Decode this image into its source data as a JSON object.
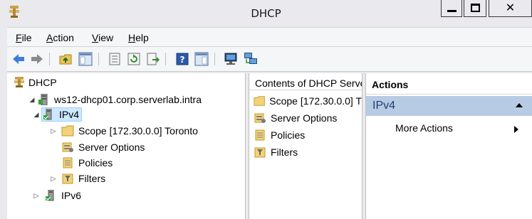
{
  "window": {
    "title": "DHCP"
  },
  "menu": {
    "file": {
      "key": "F",
      "rest": "ile"
    },
    "action": {
      "key": "A",
      "rest": "ction"
    },
    "view": {
      "key": "V",
      "rest": "iew"
    },
    "help": {
      "key": "H",
      "rest": "elp"
    }
  },
  "tree": {
    "root": "DHCP",
    "server": "ws12-dhcp01.corp.serverlab.intra",
    "ipv4": "IPv4",
    "scope": "Scope [172.30.0.0] Toronto",
    "server_options": "Server Options",
    "policies": "Policies",
    "filters": "Filters",
    "ipv6": "IPv6"
  },
  "content": {
    "header": "Contents of DHCP Server",
    "items": [
      "Scope [172.30.0.0] T",
      "Server Options",
      "Policies",
      "Filters"
    ]
  },
  "actions": {
    "header": "Actions",
    "section": "IPv4",
    "more": "More Actions"
  },
  "colors": {
    "selection": "#cce8ff",
    "action_section": "#b8cbe4",
    "back_arrow": "#3d7fd6"
  }
}
